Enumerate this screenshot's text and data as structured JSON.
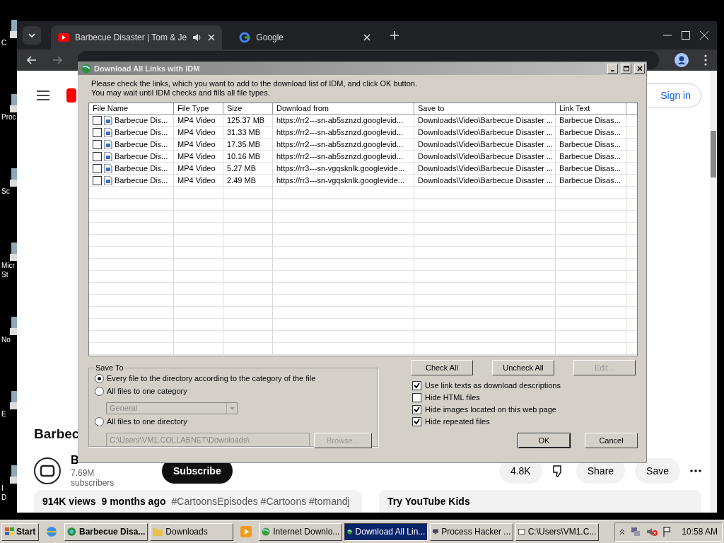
{
  "desktop_icons": [
    {
      "lines": [
        "C"
      ]
    },
    {
      "lines": [
        "Proc"
      ]
    },
    {
      "lines": [
        "Sc"
      ]
    },
    {
      "lines": [
        "Micr",
        "St"
      ]
    },
    {
      "lines": [
        "No"
      ]
    },
    {
      "lines": [
        "E"
      ]
    },
    {
      "lines": [
        "I",
        "D"
      ]
    }
  ],
  "browser": {
    "tabs": [
      {
        "title": "Barbecue Disaster | Tom & Je",
        "selected": true,
        "audio": true
      },
      {
        "title": "Google",
        "selected": false,
        "audio": false
      }
    ]
  },
  "youtube": {
    "sign_in": "Sign in",
    "video_title": "Barbec",
    "channel_name": "B",
    "subscribers": "7.69M subscribers",
    "subscribe": "Subscribe",
    "likes": "4.8K",
    "share": "Share",
    "save": "Save",
    "views": "914K views",
    "age": "9 months ago",
    "hashtags": "#CartoonsEpisodes #Cartoons #tomandj",
    "kids": "Try YouTube Kids"
  },
  "dialog": {
    "title": "Download All Links with IDM",
    "intro": [
      "Please check the links, which you want to add to the download list of IDM, and click OK button.",
      "You may wait until IDM checks and fills all file types."
    ],
    "columns": [
      "File Name",
      "File Type",
      "Size",
      "Download from",
      "Save to",
      "Link Text"
    ],
    "rows": [
      {
        "checked": false,
        "cells": [
          "Barbecue Dis...",
          "MP4 Video",
          "125.37  MB",
          "https://rr2---sn-ab5sznzd.googlevid...",
          "Downloads\\Video\\Barbecue Disaster ...",
          "Barbecue Disas..."
        ]
      },
      {
        "checked": false,
        "cells": [
          "Barbecue Dis...",
          "MP4 Video",
          "31.33  MB",
          "https://rr2---sn-ab5sznzd.googlevid...",
          "Downloads\\Video\\Barbecue Disaster ...",
          "Barbecue Disas..."
        ]
      },
      {
        "checked": false,
        "cells": [
          "Barbecue Dis...",
          "MP4 Video",
          "17.35  MB",
          "https://rr2---sn-ab5sznzd.googlevid...",
          "Downloads\\Video\\Barbecue Disaster ...",
          "Barbecue Disas..."
        ]
      },
      {
        "checked": false,
        "cells": [
          "Barbecue Dis...",
          "MP4 Video",
          "10.16  MB",
          "https://rr2---sn-ab5sznzd.googlevid...",
          "Downloads\\Video\\Barbecue Disaster ...",
          "Barbecue Disas..."
        ]
      },
      {
        "checked": false,
        "cells": [
          "Barbecue Dis...",
          "MP4 Video",
          "5.27  MB",
          "https://rr3---sn-vgqsknlk.googlevide...",
          "Downloads\\Video\\Barbecue Disaster ...",
          "Barbecue Disas..."
        ]
      },
      {
        "checked": false,
        "cells": [
          "Barbecue Dis...",
          "MP4 Video",
          "2.49  MB",
          "https://rr3---sn-vgqsknlk.googlevide...",
          "Downloads\\Video\\Barbecue Disaster ...",
          "Barbecue Disas..."
        ]
      }
    ],
    "save_to": {
      "title": "Save To",
      "options": [
        {
          "label": "Every file to the directory according to the category of the file",
          "selected": true
        },
        {
          "label": "All files to one category",
          "selected": false
        },
        {
          "label": "All files to one directory",
          "selected": false
        }
      ],
      "category": {
        "value": "General",
        "disabled": true
      },
      "directory": {
        "value": "C:\\Users\\VM1.COLLABNET\\Downloads\\",
        "disabled": true
      },
      "browse": {
        "label": "Browse...",
        "disabled": true
      }
    },
    "buttons": [
      {
        "label": "Check All",
        "disabled": false
      },
      {
        "label": "Uncheck All",
        "disabled": false
      },
      {
        "label": "Edit...",
        "disabled": true
      }
    ],
    "options": [
      {
        "label": "Use link texts as download descriptions",
        "checked": true
      },
      {
        "label": "Hide HTML files",
        "checked": false
      },
      {
        "label": "Hide images located on this web page",
        "checked": true
      },
      {
        "label": "Hide repeated files",
        "checked": true
      }
    ],
    "ok": "OK",
    "cancel": "Cancel"
  },
  "taskbar": {
    "start": "Start",
    "items": [
      {
        "kind": "browser"
      },
      {
        "kind": "chrome",
        "label": "Barbecue Disa...",
        "selected": false,
        "bold": true
      },
      {
        "kind": "folder",
        "label": "Downloads",
        "selected": false,
        "bold": false
      },
      {
        "kind": "player"
      },
      {
        "kind": "downloader",
        "label": "Internet Downlo...",
        "selected": false,
        "bold": false
      },
      {
        "kind": "downloader",
        "label": "Download All Lin...",
        "selected": true,
        "bold": false
      },
      {
        "kind": "monitor",
        "label": "Process Hacker ...",
        "selected": false,
        "bold": false
      },
      {
        "kind": "archive",
        "label": "C:\\Users\\VM1.C...",
        "selected": false,
        "bold": false
      }
    ],
    "time": "10:58 AM"
  }
}
